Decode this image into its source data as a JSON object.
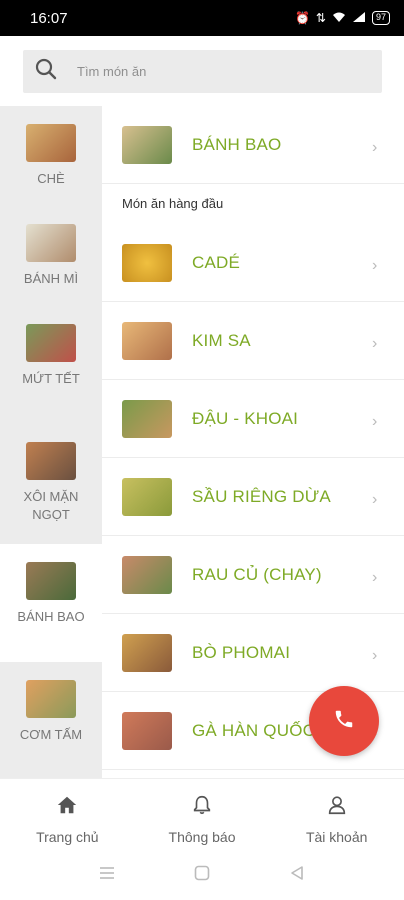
{
  "status": {
    "time": "16:07",
    "battery": "97"
  },
  "search": {
    "placeholder": "Tìm món ăn"
  },
  "categories": [
    {
      "label": "CHÈ",
      "color": "#c79a5a"
    },
    {
      "label": "BÁNH MÌ",
      "color": "#b08c6c"
    },
    {
      "label": "MỨT TẾT",
      "color": "#a85a4a"
    },
    {
      "label": "XÔI MẶN NGỌT",
      "color": "#a07048"
    },
    {
      "label": "BÁNH BAO",
      "color": "#8a6a4a"
    },
    {
      "label": "CƠM TẤM",
      "color": "#c8884a"
    }
  ],
  "list": {
    "top_item": {
      "name": "BÁNH BAO",
      "color": "#9a7a56"
    },
    "section_title": "Món ăn hàng đầu",
    "items": [
      {
        "name": "CADÉ",
        "color": "#e2b94a"
      },
      {
        "name": "KIM SA",
        "color": "#d4a060"
      },
      {
        "name": "ĐẬU - KHOAI",
        "color": "#a6884a"
      },
      {
        "name": "SẦU RIÊNG DỪA",
        "color": "#c2b25a"
      },
      {
        "name": "RAU CỦ (CHAY)",
        "color": "#b47a5a"
      },
      {
        "name": "BÒ PHOMAI",
        "color": "#b08a3c"
      },
      {
        "name": "GÀ HÀN QUỐC",
        "color": "#b46a4a"
      }
    ]
  },
  "bottom_nav": [
    {
      "label": "Trang chủ",
      "icon": "home-icon"
    },
    {
      "label": "Thông báo",
      "icon": "bell-icon"
    },
    {
      "label": "Tài khoản",
      "icon": "user-icon"
    }
  ],
  "colors": {
    "accent": "#7eaa26",
    "fab": "#e8483c"
  }
}
